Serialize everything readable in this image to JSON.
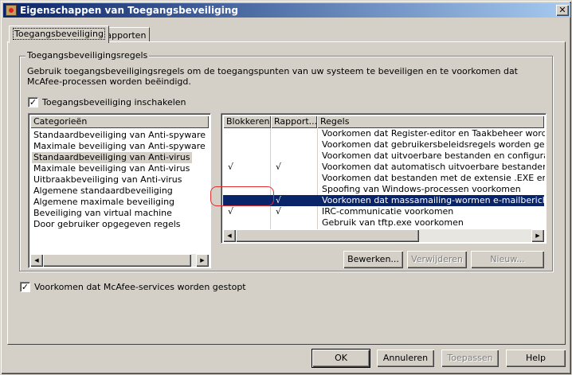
{
  "window": {
    "title": "Eigenschappen van Toegangsbeveiliging",
    "close": "✕"
  },
  "tabs": [
    "Toegangsbeveiliging",
    "Rapporten"
  ],
  "group": {
    "legend": "Toegangsbeveiligingsregels",
    "description": "Gebruik toegangsbeveiligingsregels om de toegangspunten van uw systeem te beveiligen en te voorkomen dat McAfee-processen worden beëindigd.",
    "enable_label": "Toegangsbeveiliging inschakelen",
    "enable_checked": true
  },
  "categories": {
    "header": "Categorieën",
    "items": [
      "Standaardbeveiliging van Anti-spyware",
      "Maximale beveiliging van Anti-spyware",
      "Standaardbeveiliging van Anti-virus",
      "Maximale beveiliging van Anti-virus",
      "Uitbraakbeveiliging van Anti-virus",
      "Algemene standaardbeveiliging",
      "Algemene maximale beveiliging",
      "Beveiliging van virtual machine",
      "Door gebruiker opgegeven regels"
    ],
    "selected_index": 2
  },
  "rules": {
    "headers": {
      "block": "Blokkeren",
      "report": "Rapport...",
      "rule": "Regels"
    },
    "rows": [
      {
        "block": "",
        "report": "",
        "rule": "Voorkomen dat Register-editor en Taakbeheer worden uitgeschakeld"
      },
      {
        "block": "",
        "report": "",
        "rule": "Voorkomen dat gebruikersbeleidsregels worden gewijzigd"
      },
      {
        "block": "",
        "report": "",
        "rule": "Voorkomen dat uitvoerbare bestanden en configuratiebestanden worden gewijzigd"
      },
      {
        "block": "√",
        "report": "√",
        "rule": "Voorkomen dat automatisch uitvoerbare bestanden vanaf externe apparaten"
      },
      {
        "block": "",
        "report": "",
        "rule": "Voorkomen dat bestanden met de extensie .EXE en andere"
      },
      {
        "block": "",
        "report": "",
        "rule": "Spoofing van Windows-processen voorkomen"
      },
      {
        "block": "",
        "report": "√",
        "rule": "Voorkomen dat massamailing-wormen e-mailberichten verzenden"
      },
      {
        "block": "√",
        "report": "√",
        "rule": "IRC-communicatie voorkomen"
      },
      {
        "block": "",
        "report": "",
        "rule": "Gebruik van tftp.exe voorkomen"
      }
    ],
    "selected_index": 6
  },
  "rule_buttons": {
    "edit": "Bewerken...",
    "delete": "Verwijderen",
    "new": "Nieuw..."
  },
  "services_label": "Voorkomen dat McAfee-services worden gestopt",
  "services_checked": true,
  "footer": {
    "ok": "OK",
    "cancel": "Annuleren",
    "apply": "Toepassen",
    "help": "Help"
  },
  "checkmark": "✓",
  "colors": {
    "selection": "#0a246a",
    "annotation": "#e03030"
  }
}
